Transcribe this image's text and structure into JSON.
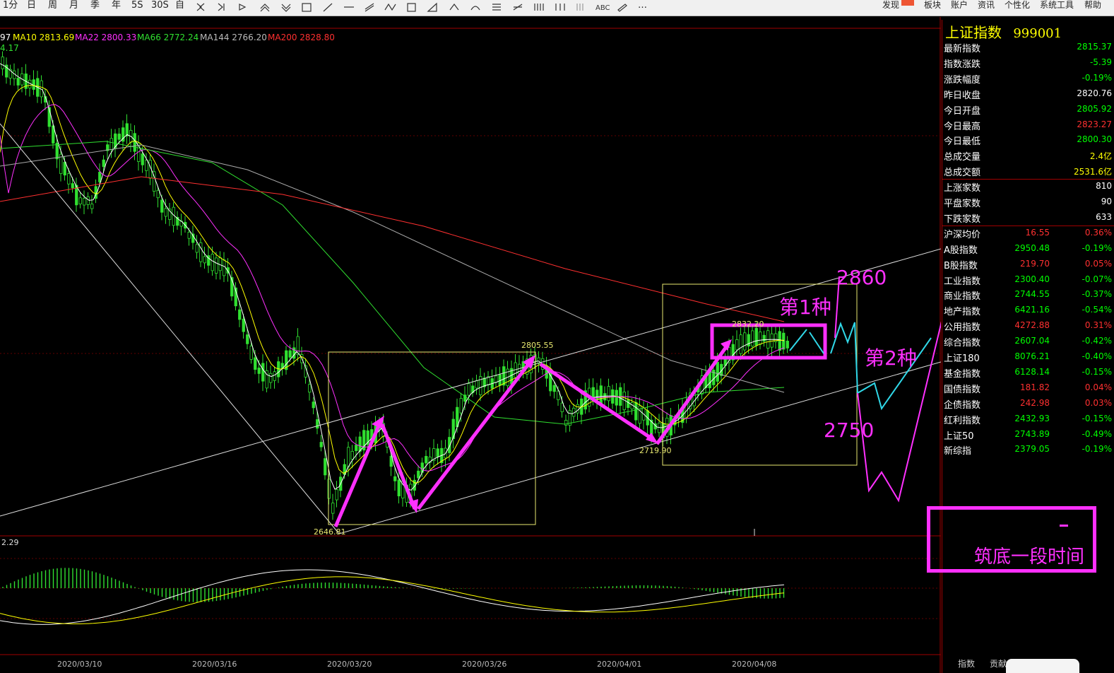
{
  "toolbar": {
    "periods": [
      "1分",
      "日",
      "周",
      "月",
      "季",
      "年",
      "5S",
      "30S",
      "自"
    ],
    "right_menu": [
      "发现",
      "板块",
      "账户",
      "资讯",
      "个性化",
      "系统工具",
      "帮助"
    ],
    "more": "…",
    "abc": "ABC"
  },
  "legend": {
    "ma5": "97",
    "ma10": "MA10 2813.69",
    "ma22": "MA22 2800.33",
    "ma66": "MA66 2772.24",
    "ma144": "MA144 2766.20",
    "ma200": "MA200 2828.80",
    "top_left_value": "4.17"
  },
  "price_labels": {
    "high1": "2805.55",
    "low1": "2646.81",
    "low2": "2719.90",
    "recent_high": "2832.20"
  },
  "macd_label": "2.29",
  "dates": [
    "2020/03/10",
    "2020/03/16",
    "2020/03/20",
    "2020/03/26",
    "2020/04/01",
    "2020/04/08"
  ],
  "annotations": {
    "first": "第1种",
    "second": "第2种",
    "high": "2860",
    "low": "2750",
    "bottom": "筑底一段时间"
  },
  "info": {
    "title": "上证指数",
    "code": "999001",
    "rows": [
      {
        "label": "最新指数",
        "v1": "",
        "v2": "2815.37",
        "c2": "#00ff00"
      },
      {
        "label": "指数涨跌",
        "v1": "",
        "v2": "-5.39",
        "c2": "#00ff00"
      },
      {
        "label": "涨跌幅度",
        "v1": "",
        "v2": "-0.19%",
        "c2": "#00ff00"
      },
      {
        "label": "昨日收盘",
        "v1": "",
        "v2": "2820.76",
        "c2": "#ffffff"
      },
      {
        "label": "今日开盘",
        "v1": "",
        "v2": "2805.92",
        "c2": "#00ff00"
      },
      {
        "label": "今日最高",
        "v1": "",
        "v2": "2823.27",
        "c2": "#ff3030"
      },
      {
        "label": "今日最低",
        "v1": "",
        "v2": "2800.30",
        "c2": "#00ff00"
      },
      {
        "label": "总成交量",
        "v1": "",
        "v2": "2.4亿",
        "c2": "#ffff00"
      },
      {
        "label": "总成交额",
        "v1": "",
        "v2": "2531.6亿",
        "c2": "#ffff00"
      },
      {
        "label": "上涨家数",
        "v1": "",
        "v2": "810",
        "c2": "#ffffff"
      },
      {
        "label": "平盘家数",
        "v1": "",
        "v2": "90",
        "c2": "#ffffff"
      },
      {
        "label": "下跌家数",
        "v1": "",
        "v2": "633",
        "c2": "#ffffff"
      },
      {
        "label": "沪深均价",
        "v1": "16.55",
        "v2": "0.36%",
        "c1": "#ff3030",
        "c2": "#ff3030"
      },
      {
        "label": "A股指数",
        "v1": "2950.48",
        "v2": "-0.19%",
        "c1": "#00ff00",
        "c2": "#00ff00"
      },
      {
        "label": "B股指数",
        "v1": "219.70",
        "v2": "0.05%",
        "c1": "#ff3030",
        "c2": "#ff3030"
      },
      {
        "label": "工业指数",
        "v1": "2300.40",
        "v2": "-0.07%",
        "c1": "#00ff00",
        "c2": "#00ff00"
      },
      {
        "label": "商业指数",
        "v1": "2744.55",
        "v2": "-0.37%",
        "c1": "#00ff00",
        "c2": "#00ff00"
      },
      {
        "label": "地产指数",
        "v1": "6421.16",
        "v2": "-0.54%",
        "c1": "#00ff00",
        "c2": "#00ff00"
      },
      {
        "label": "公用指数",
        "v1": "4272.88",
        "v2": "0.31%",
        "c1": "#ff3030",
        "c2": "#ff3030"
      },
      {
        "label": "综合指数",
        "v1": "2607.04",
        "v2": "-0.42%",
        "c1": "#00ff00",
        "c2": "#00ff00"
      },
      {
        "label": "上证180",
        "v1": "8076.21",
        "v2": "-0.40%",
        "c1": "#00ff00",
        "c2": "#00ff00"
      },
      {
        "label": "基金指数",
        "v1": "6128.14",
        "v2": "-0.15%",
        "c1": "#00ff00",
        "c2": "#00ff00"
      },
      {
        "label": "国债指数",
        "v1": "181.82",
        "v2": "0.04%",
        "c1": "#ff3030",
        "c2": "#ff3030"
      },
      {
        "label": "企债指数",
        "v1": "242.98",
        "v2": "0.03%",
        "c1": "#ff3030",
        "c2": "#ff3030"
      },
      {
        "label": "红利指数",
        "v1": "2432.93",
        "v2": "-0.15%",
        "c1": "#00ff00",
        "c2": "#00ff00"
      },
      {
        "label": "上证50",
        "v1": "2743.89",
        "v2": "-0.49%",
        "c1": "#00ff00",
        "c2": "#00ff00"
      },
      {
        "label": "新综指",
        "v1": "2379.05",
        "v2": "-0.19%",
        "c1": "#00ff00",
        "c2": "#00ff00"
      }
    ]
  },
  "bottom_tabs": [
    "指数",
    "贡献"
  ]
}
